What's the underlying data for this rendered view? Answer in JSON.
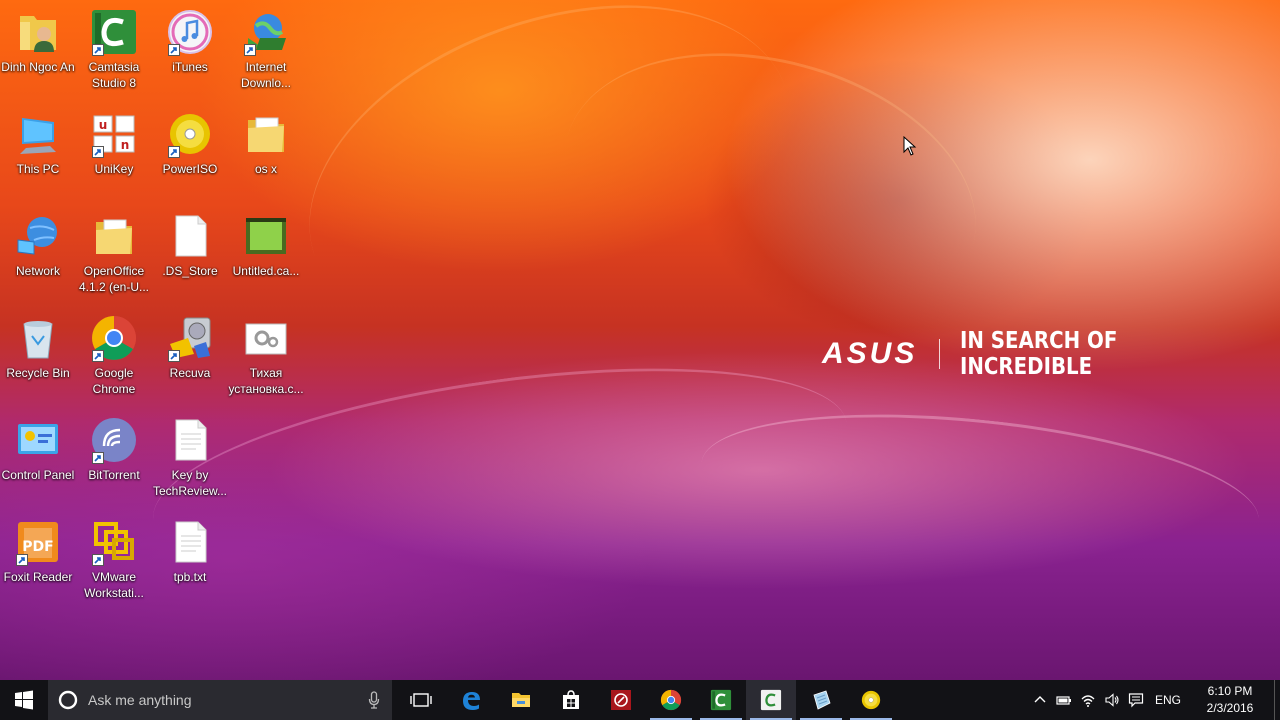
{
  "desktop": {
    "icons": [
      {
        "label": "Dinh Ngoc An",
        "icon": "user-folder-icon",
        "shortcut": false
      },
      {
        "label": "Camtasia Studio 8",
        "icon": "camtasia-icon",
        "shortcut": true
      },
      {
        "label": "iTunes",
        "icon": "itunes-icon",
        "shortcut": true
      },
      {
        "label": "Internet Downlo...",
        "icon": "idm-icon",
        "shortcut": true
      },
      {
        "label": "This PC",
        "icon": "computer-icon",
        "shortcut": false
      },
      {
        "label": "UniKey",
        "icon": "unikey-icon",
        "shortcut": true
      },
      {
        "label": "PowerISO",
        "icon": "poweriso-icon",
        "shortcut": true
      },
      {
        "label": "os x",
        "icon": "folder-icon",
        "shortcut": false
      },
      {
        "label": "Network",
        "icon": "network-icon",
        "shortcut": false
      },
      {
        "label": "OpenOffice 4.1.2 (en-U...",
        "icon": "folder-icon",
        "shortcut": false
      },
      {
        "label": ".DS_Store",
        "icon": "blank-file-icon",
        "shortcut": false
      },
      {
        "label": "Untitled.ca...",
        "icon": "camtasia-project-icon",
        "shortcut": false
      },
      {
        "label": "Recycle Bin",
        "icon": "recycle-bin-icon",
        "shortcut": false
      },
      {
        "label": "Google Chrome",
        "icon": "chrome-icon",
        "shortcut": true
      },
      {
        "label": "Recuva",
        "icon": "recuva-icon",
        "shortcut": true
      },
      {
        "label": "Тихая установка.с...",
        "icon": "settings-file-icon",
        "shortcut": false
      },
      {
        "label": "Control Panel",
        "icon": "control-panel-icon",
        "shortcut": false
      },
      {
        "label": "BitTorrent",
        "icon": "bittorrent-icon",
        "shortcut": true
      },
      {
        "label": "Key by TechReview...",
        "icon": "text-file-icon",
        "shortcut": false
      },
      {
        "label": "Foxit Reader",
        "icon": "foxit-reader-icon",
        "shortcut": true
      },
      {
        "label": "VMware Workstati...",
        "icon": "vmware-icon",
        "shortcut": true
      },
      {
        "label": "tpb.txt",
        "icon": "text-file-icon",
        "shortcut": false
      }
    ]
  },
  "wallpaper": {
    "brand": "ASUS",
    "slogan": "IN SEARCH OF INCREDIBLE"
  },
  "taskbar": {
    "search_placeholder": "Ask me anything",
    "apps": [
      {
        "icon": "task-view-icon",
        "running": false
      },
      {
        "icon": "edge-icon",
        "running": false
      },
      {
        "icon": "file-explorer-icon",
        "running": false
      },
      {
        "icon": "store-icon",
        "running": false
      },
      {
        "icon": "app-red-icon",
        "running": false
      },
      {
        "icon": "chrome-icon",
        "running": true
      },
      {
        "icon": "camtasia-icon",
        "running": true
      },
      {
        "icon": "camtasia-recorder-icon",
        "running": true
      },
      {
        "icon": "notepad-icon",
        "running": true
      },
      {
        "icon": "poweriso-icon",
        "running": true
      }
    ],
    "language": "ENG",
    "time": "6:10 PM",
    "date": "2/3/2016"
  },
  "colors": {
    "taskbar_bg": "#121216",
    "search_bg": "#2a2a30",
    "running_indicator": "#9ab8e8"
  }
}
